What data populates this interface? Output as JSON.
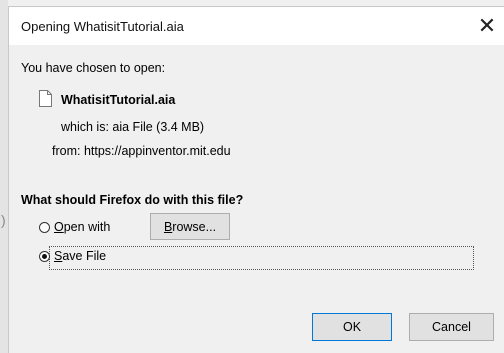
{
  "dialog": {
    "title": "Opening WhatisitTutorial.aia",
    "close_label": "✕",
    "chosen_label": "You have chosen to open:",
    "file_name": "WhatisitTutorial.aia",
    "which_is": "which is:  aia File (3.4 MB)",
    "from": "from:  https://appinventor.mit.edu",
    "question": "What should Firefox do with this file?",
    "options": {
      "open_with": "Open with",
      "save_file": "Save File",
      "selected": "save_file"
    },
    "browse_label": "Browse...",
    "ok_label": "OK",
    "cancel_label": "Cancel"
  },
  "outer": {
    "mark": ")"
  },
  "colors": {
    "titlebar": "#ffffff",
    "body": "#f0f0f0",
    "default_button_border": "#0078d7"
  },
  "icons": [
    "file-icon",
    "close-icon",
    "radio-open-with",
    "radio-save-file"
  ]
}
